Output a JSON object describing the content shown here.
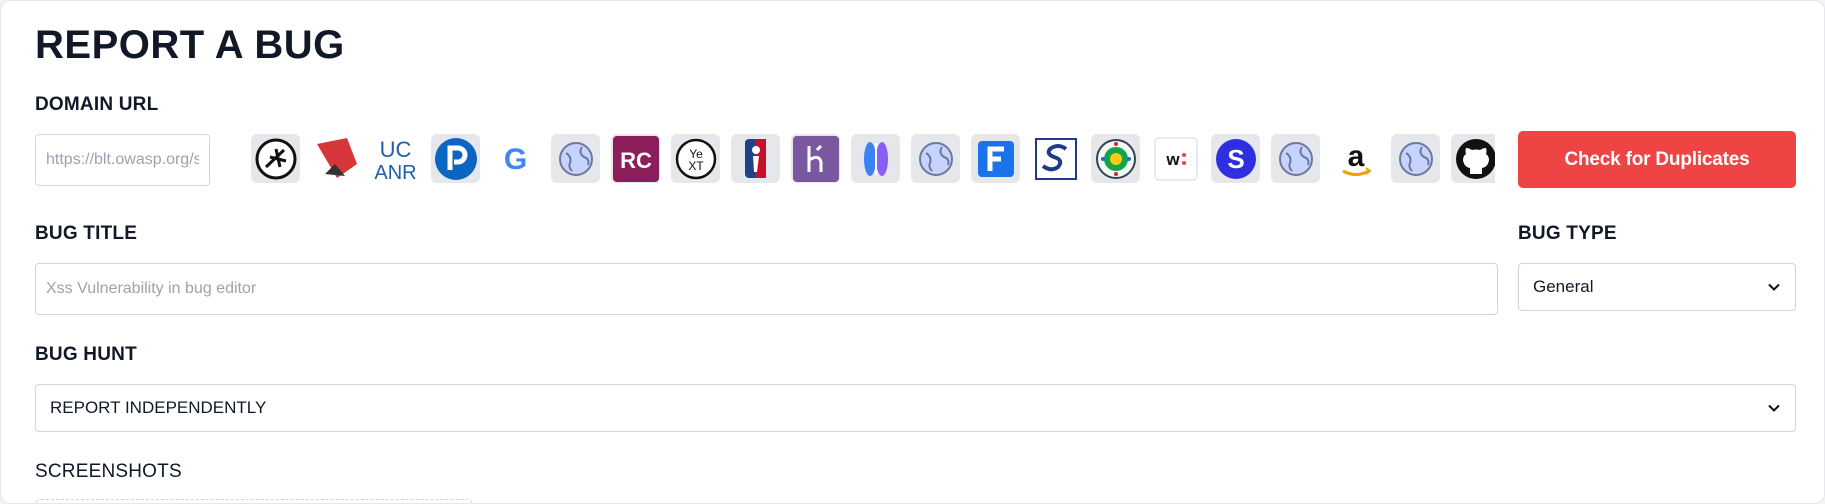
{
  "page": {
    "title": "REPORT A BUG"
  },
  "domain": {
    "label": "DOMAIN URL",
    "placeholder": "https://blt.owasp.org/s",
    "logos": [
      "owasp-icon",
      "red-stairs-icon",
      "ucanr-icon",
      "paypal-icon",
      "google-icon",
      "globe-icon",
      "rc-icon",
      "yext-icon",
      "nba-icon",
      "heroku-icon",
      "fluid-icon",
      "globe-icon",
      "fortinet-icon",
      "sentinel-icon",
      "seal-icon",
      "wikiloc-icon",
      "s-circle-icon",
      "globe-icon",
      "amazon-icon",
      "globe-icon",
      "github-icon"
    ],
    "check_button": "Check for Duplicates"
  },
  "bug_title": {
    "label": "BUG TITLE",
    "placeholder": "Xss Vulnerability in bug editor"
  },
  "bug_type": {
    "label": "BUG TYPE",
    "value": "General"
  },
  "bug_hunt": {
    "label": "BUG HUNT",
    "value": "REPORT INDEPENDENTLY"
  },
  "screenshots": {
    "label": "SCREENSHOTS"
  },
  "colors": {
    "accent": "#ef4444",
    "text": "#111827",
    "border": "#d1d5db"
  }
}
